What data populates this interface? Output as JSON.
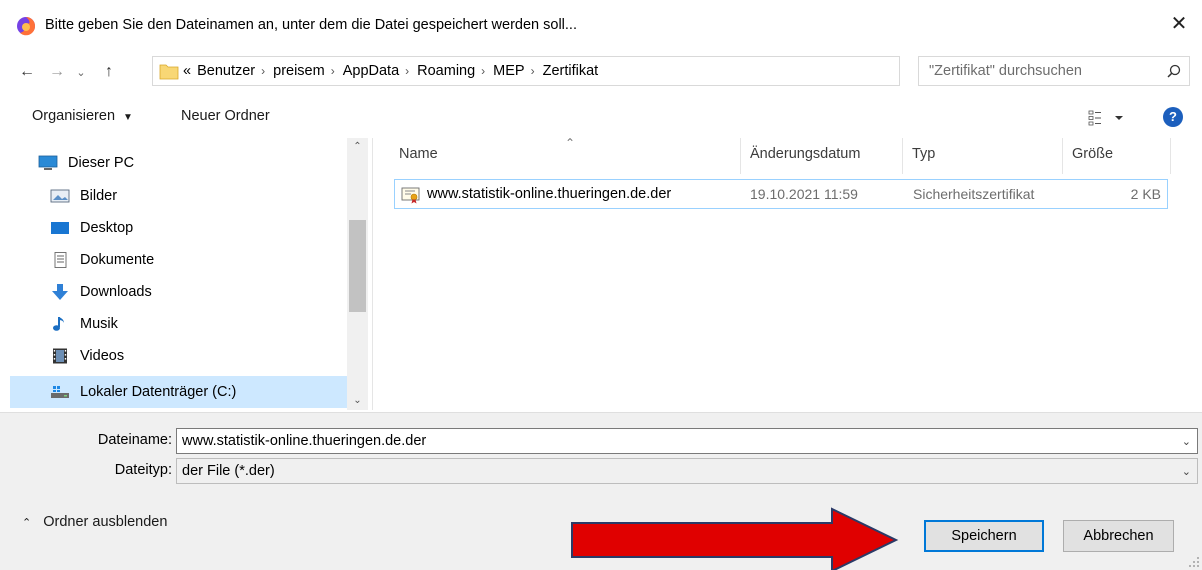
{
  "window": {
    "title": "Bitte geben Sie den Dateinamen an, unter dem die Datei gespeichert werden soll...",
    "app_icon": "firefox-icon",
    "close_glyph": "✕"
  },
  "navigation": {
    "back_glyph": "←",
    "forward_glyph": "→",
    "recent_glyph": "⌄",
    "up_glyph": "↑",
    "breadcrumb": [
      {
        "label": "«"
      },
      {
        "label": "Benutzer"
      },
      {
        "label": "preisem"
      },
      {
        "label": "AppData"
      },
      {
        "label": "Roaming"
      },
      {
        "label": "MEP"
      },
      {
        "label": "Zertifikat"
      }
    ],
    "separator_glyph": "›",
    "dropdown_glyph": "⌄",
    "refresh_glyph": "↻"
  },
  "search": {
    "placeholder": "\"Zertifikat\" durchsuchen"
  },
  "toolbar": {
    "organize_label": "Organisieren",
    "organize_caret": "▼",
    "new_folder_label": "Neuer Ordner",
    "help_glyph": "?"
  },
  "sidebar": {
    "items": [
      {
        "label": "Dieser PC",
        "icon": "computer-icon"
      },
      {
        "label": "Bilder",
        "icon": "pictures-icon"
      },
      {
        "label": "Desktop",
        "icon": "desktop-icon"
      },
      {
        "label": "Dokumente",
        "icon": "documents-icon"
      },
      {
        "label": "Downloads",
        "icon": "downloads-icon"
      },
      {
        "label": "Musik",
        "icon": "music-icon"
      },
      {
        "label": "Videos",
        "icon": "videos-icon"
      },
      {
        "label": "Lokaler Datenträger (C:)",
        "icon": "drive-icon",
        "selected": true
      }
    ],
    "scroll_up_glyph": "⌃",
    "scroll_down_glyph": "⌄"
  },
  "filelist": {
    "sort_glyph": "⌃",
    "columns": [
      "Name",
      "Änderungsdatum",
      "Typ",
      "Größe"
    ],
    "rows": [
      {
        "name": "www.statistik-online.thueringen.de.der",
        "modified": "19.10.2021 11:59",
        "type": "Sicherheitszertifikat",
        "size": "2 KB",
        "icon": "certificate-icon"
      }
    ]
  },
  "form": {
    "filename_label": "Dateiname:",
    "filename_value": "www.statistik-online.thueringen.de.der",
    "filetype_label": "Dateityp:",
    "filetype_value": "der File (*.der)",
    "chevron_glyph": "⌄"
  },
  "footer": {
    "hide_folders_caret": "⌃",
    "hide_folders_label": "Ordner ausblenden",
    "save_label": "Speichern",
    "cancel_label": "Abbrechen"
  },
  "colors": {
    "annotation_arrow": "#e00000",
    "selection": "#cde8ff",
    "accent": "#0078d7"
  }
}
